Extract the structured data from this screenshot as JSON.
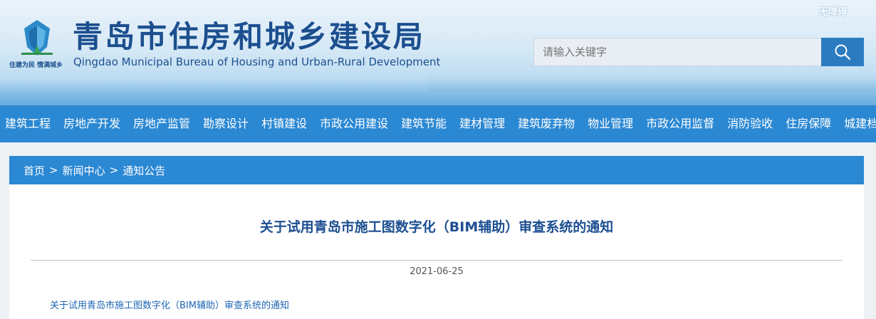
{
  "header": {
    "accessibility_label": "无障碍",
    "slogan": "住建为民 情满城乡",
    "title_cn": "青岛市住房和城乡建设局",
    "title_en": "Qingdao Municipal Bureau of Housing and Urban-Rural Development",
    "brand_color": "#1c4f8f"
  },
  "search": {
    "placeholder": "请输入关键字",
    "value": "",
    "button_icon": "search-icon"
  },
  "nav": {
    "items": [
      "建筑工程",
      "房地产开发",
      "房地产监管",
      "勘察设计",
      "村镇建设",
      "市政公用建设",
      "建筑节能",
      "建材管理",
      "建筑废弃物",
      "物业管理",
      "市政公用监督",
      "消防验收",
      "住房保障",
      "城建档案"
    ],
    "bg_color": "#2b88d3"
  },
  "breadcrumb": {
    "items": [
      "首页",
      "新闻中心",
      "通知公告"
    ],
    "separator": ">"
  },
  "article": {
    "title": "关于试用青岛市施工图数字化（BIM辅助）审查系统的通知",
    "date": "2021-06-25",
    "attachment_link": "关于试用青岛市施工图数字化（BIM辅助）审查系统的通知"
  }
}
